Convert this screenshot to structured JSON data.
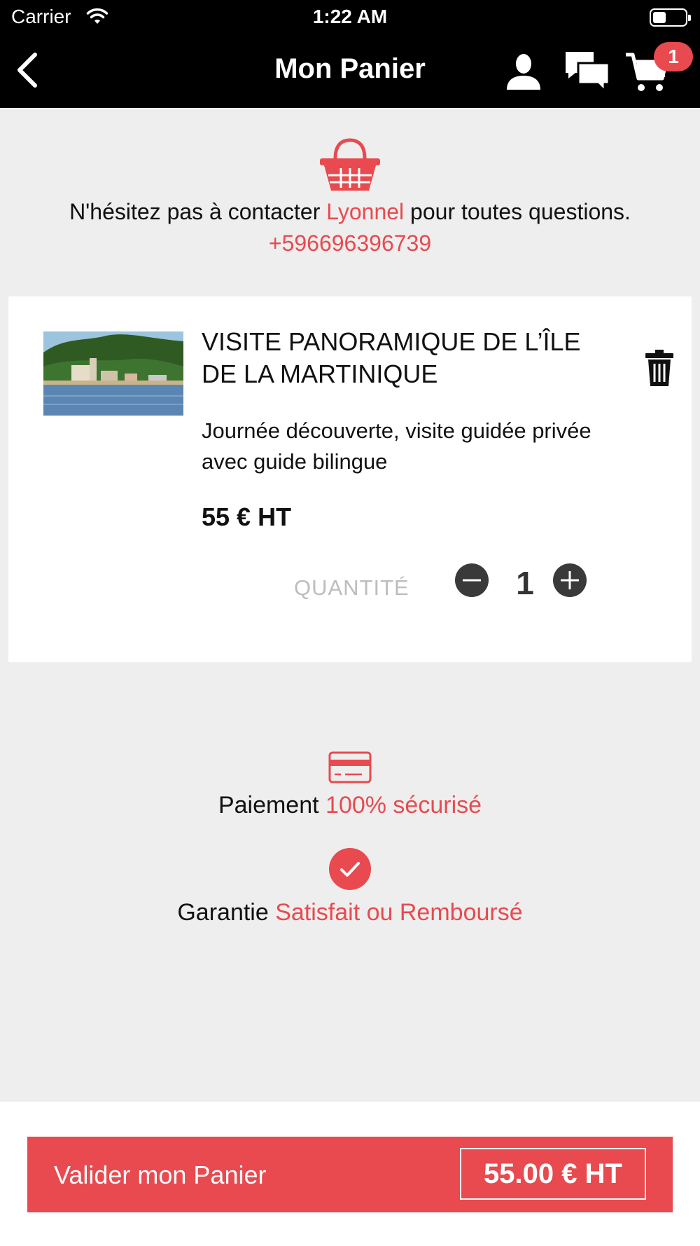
{
  "status_bar": {
    "carrier": "Carrier",
    "time": "1:22 AM"
  },
  "header": {
    "title": "Mon Panier",
    "cart_count": "1",
    "icons": [
      "back-arrow-icon",
      "user-icon",
      "chat-icon",
      "cart-icon"
    ]
  },
  "contact": {
    "text_before": "N'hésitez pas à contacter ",
    "name": "Lyonnel",
    "text_after": " pour toutes questions.",
    "phone": "+596696396739"
  },
  "cart_item": {
    "title": "VISITE PANORAMIQUE DE L’ÎLE DE LA MARTINIQUE",
    "description": "Journée découverte, visite guidée privée avec guide bilingue",
    "price": "55 € HT",
    "quantity_label": "QUANTITÉ",
    "quantity": "1"
  },
  "security": {
    "payment_prefix": "Paiement ",
    "payment_highlight": "100% sécurisé",
    "guarantee_prefix": "Garantie ",
    "guarantee_highlight": "Satisfait ou Remboursé"
  },
  "footer": {
    "validate_label": "Valider mon Panier",
    "total": "55.00 € HT"
  },
  "colors": {
    "accent": "#e84a4f",
    "header_bg": "#000000",
    "page_bg": "#eeeeee"
  }
}
